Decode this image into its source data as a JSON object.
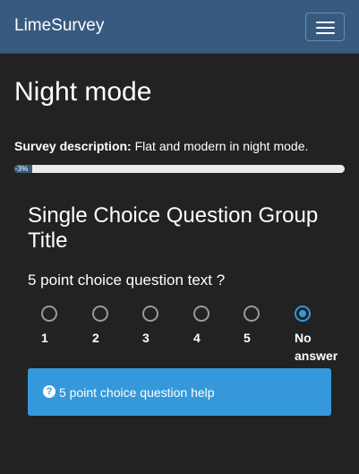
{
  "navbar": {
    "brand": "LimeSurvey",
    "menu_icon": "hamburger-menu-icon"
  },
  "survey": {
    "title": "Night mode",
    "description_label": "Survey description:",
    "description_text": "Flat and modern in night mode."
  },
  "progress": {
    "label": "-3%",
    "percent": -3
  },
  "group": {
    "title": "Single Choice Question Group Title"
  },
  "question": {
    "text": "5 point choice question text ?",
    "options": [
      {
        "label": "1",
        "checked": false
      },
      {
        "label": "2",
        "checked": false
      },
      {
        "label": "3",
        "checked": false
      },
      {
        "label": "4",
        "checked": false
      },
      {
        "label": "5",
        "checked": false
      },
      {
        "label": "No\nanswer",
        "checked": true
      }
    ],
    "help_icon": "question-circle-icon",
    "help_text": "5 point choice question help"
  },
  "colors": {
    "navbar": "#375a7f",
    "background": "#222222",
    "accent": "#3498db",
    "radio_border": "#9a9a9a"
  }
}
